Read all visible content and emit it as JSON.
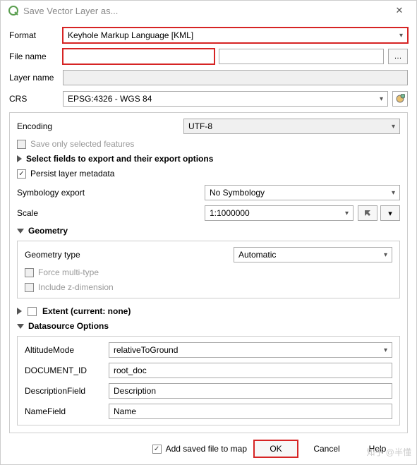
{
  "title": "Save Vector Layer as...",
  "labels": {
    "format": "Format",
    "filename": "File name",
    "layername": "Layer name",
    "crs": "CRS",
    "encoding": "Encoding",
    "saveonly": "Save only selected features",
    "selectfields": "Select fields to export and their export options",
    "persist": "Persist layer metadata",
    "symexport": "Symbology export",
    "scale": "Scale",
    "geometry": "Geometry",
    "geomtype": "Geometry type",
    "forcemulti": "Force multi-type",
    "includez": "Include z-dimension",
    "extent": "Extent (current: none)",
    "dsoptions": "Datasource Options",
    "altmode": "AltitudeMode",
    "docid": "DOCUMENT_ID",
    "descfield": "DescriptionField",
    "namefield": "NameField",
    "addsaved": "Add saved file to map"
  },
  "values": {
    "format": "Keyhole Markup Language [KML]",
    "crs": "EPSG:4326 - WGS 84",
    "encoding": "UTF-8",
    "symexport": "No Symbology",
    "scale": "1:1000000",
    "geomtype": "Automatic",
    "altmode": "relativeToGround",
    "docid": "root_doc",
    "descfield": "Description",
    "namefield": "Name"
  },
  "buttons": {
    "ok": "OK",
    "cancel": "Cancel",
    "help": "Help",
    "browse": "…"
  },
  "watermark": "知乎 @半懂"
}
